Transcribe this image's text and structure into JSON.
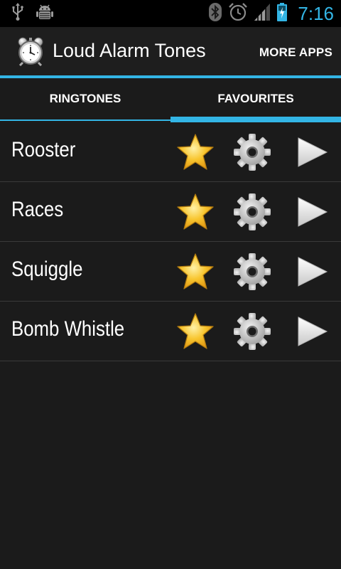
{
  "status_bar": {
    "time": "7:16",
    "left_icons": [
      "usb-icon",
      "android-debug-icon"
    ],
    "right_icons": [
      "bluetooth-icon",
      "alarm-icon",
      "signal-icon",
      "battery-icon"
    ]
  },
  "action_bar": {
    "title": "Loud Alarm Tones",
    "app_icon": "alarm-clock-icon",
    "more_apps_label": "MORE APPS"
  },
  "tabs": [
    {
      "label": "RINGTONES",
      "selected": false
    },
    {
      "label": "FAVOURITES",
      "selected": true
    }
  ],
  "items": [
    {
      "name": "Rooster"
    },
    {
      "name": "Races"
    },
    {
      "name": "Squiggle"
    },
    {
      "name": "Bomb Whistle"
    }
  ],
  "colors": {
    "accent": "#33b5e5",
    "star": "#f5c12b",
    "background": "#1b1b1b"
  }
}
